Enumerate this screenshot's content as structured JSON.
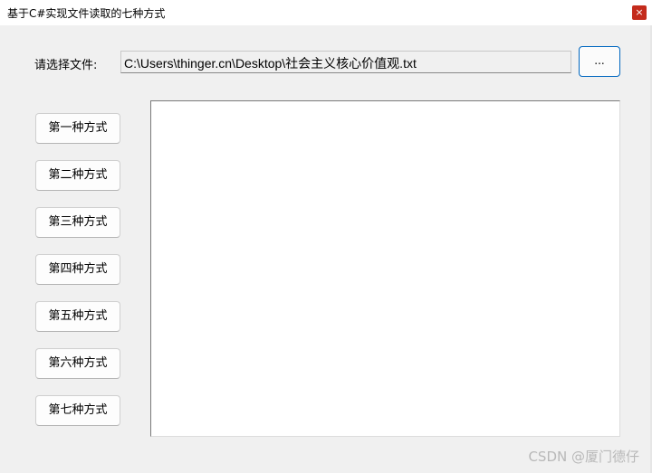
{
  "window": {
    "title": "基于C#实现文件读取的七种方式",
    "close_label": "×"
  },
  "file_select": {
    "label": "请选择文件:",
    "path": "C:\\Users\\thinger.cn\\Desktop\\社会主义核心价值观.txt",
    "browse_label": "..."
  },
  "methods": [
    {
      "label": "第一种方式"
    },
    {
      "label": "第二种方式"
    },
    {
      "label": "第三种方式"
    },
    {
      "label": "第四种方式"
    },
    {
      "label": "第五种方式"
    },
    {
      "label": "第六种方式"
    },
    {
      "label": "第七种方式"
    }
  ],
  "content": {
    "text": ""
  },
  "watermark": "CSDN @厦门德仔",
  "colors": {
    "close_button": "#c42b1c",
    "browse_border": "#0067c0",
    "window_background": "#f0f0f0"
  }
}
